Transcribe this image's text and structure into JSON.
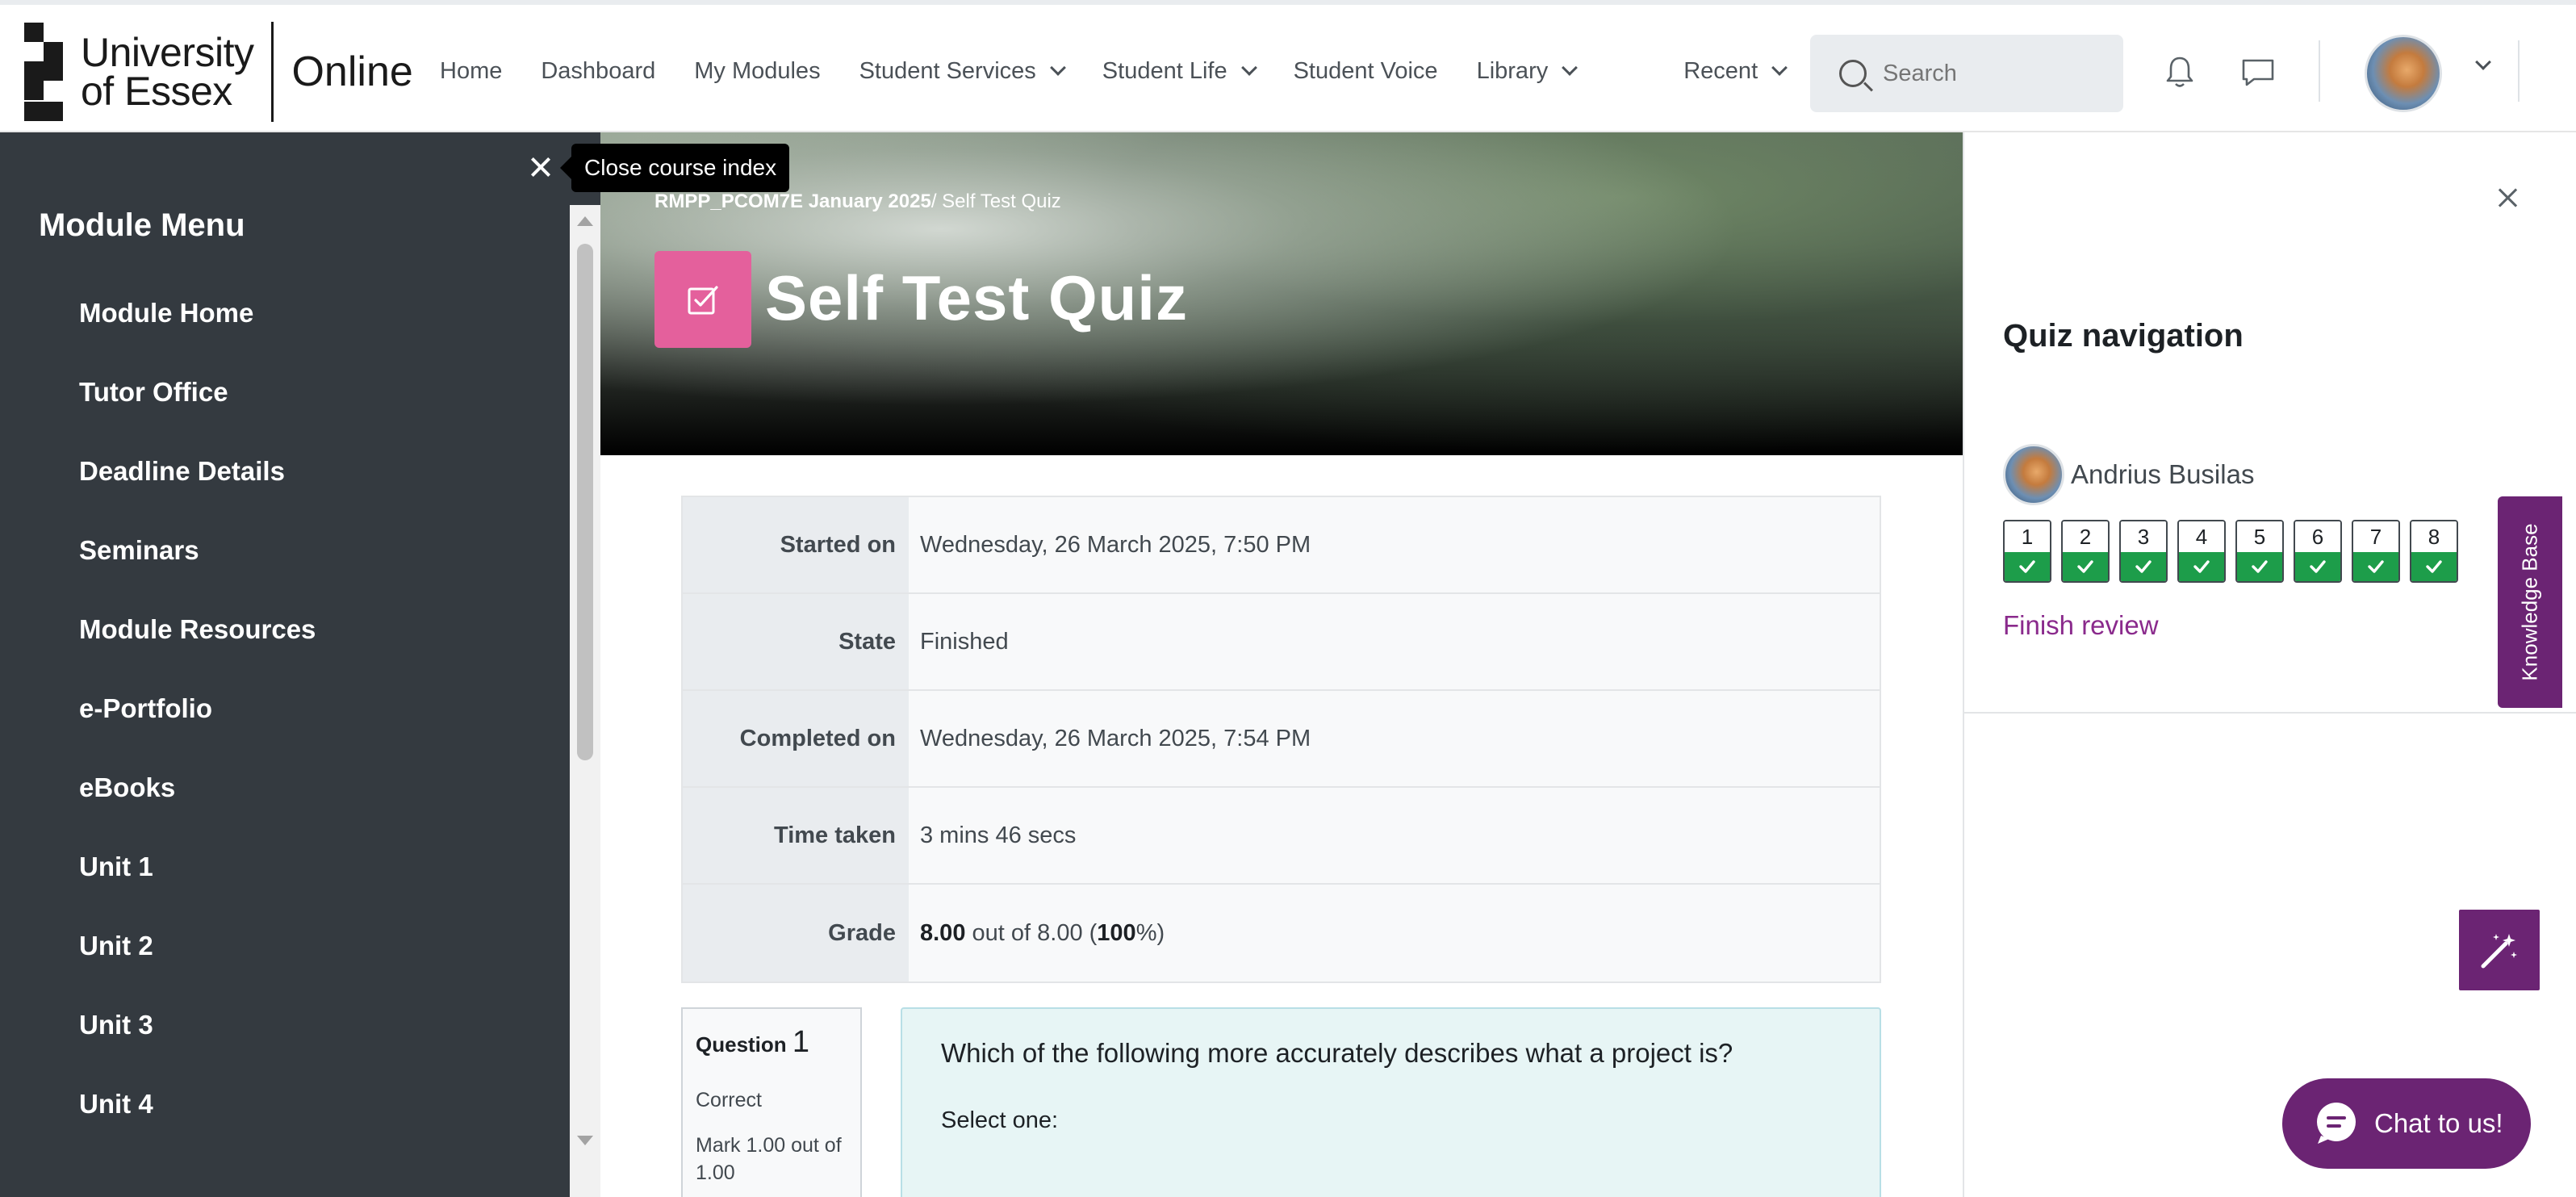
{
  "brand": {
    "university_line1": "University",
    "university_line2": "of Essex",
    "online": "Online"
  },
  "nav": {
    "items": [
      {
        "label": "Home",
        "dropdown": false
      },
      {
        "label": "Dashboard",
        "dropdown": false
      },
      {
        "label": "My Modules",
        "dropdown": false
      },
      {
        "label": "Student Services",
        "dropdown": true
      },
      {
        "label": "Student Life",
        "dropdown": true
      },
      {
        "label": "Student Voice",
        "dropdown": false
      },
      {
        "label": "Library",
        "dropdown": true
      }
    ],
    "recent": "Recent",
    "search_placeholder": "Search"
  },
  "drawer": {
    "close_tooltip": "Close course index",
    "title": "Module Menu",
    "items": [
      "Module Home",
      "Tutor Office",
      "Deadline Details",
      "Seminars",
      "Module Resources",
      "e-Portfolio",
      "eBooks",
      "Unit 1",
      "Unit 2",
      "Unit 3",
      "Unit 4"
    ]
  },
  "hero": {
    "breadcrumb_course": "RMPP_PCOM7E January 2025",
    "breadcrumb_separator": "/",
    "breadcrumb_page": "Self Test Quiz",
    "title": "Self Test Quiz",
    "icon_color": "#e4609c"
  },
  "summary": {
    "rows": [
      {
        "label": "Started on",
        "value": "Wednesday, 26 March 2025, 7:50 PM"
      },
      {
        "label": "State",
        "value": "Finished"
      },
      {
        "label": "Completed on",
        "value": "Wednesday, 26 March 2025, 7:54 PM"
      },
      {
        "label": "Time taken",
        "value": "3 mins 46 secs"
      }
    ],
    "grade_label": "Grade",
    "grade_score": "8.00",
    "grade_mid": "out of 8.00 (",
    "grade_percent": "100",
    "grade_end": "%)"
  },
  "question": {
    "label": "Question",
    "number": "1",
    "state": "Correct",
    "mark": "Mark 1.00 out of 1.00",
    "text": "Which of the following more accurately describes what a project is?",
    "select_prompt": "Select one:"
  },
  "quiz_nav": {
    "title": "Quiz navigation",
    "user": "Andrius Busilas",
    "questions": [
      "1",
      "2",
      "3",
      "4",
      "5",
      "6",
      "7",
      "8"
    ],
    "question_state": "correct",
    "finish_review": "Finish review"
  },
  "side_tabs": {
    "knowledge_base": "Knowledge Base"
  },
  "chat": {
    "label": "Chat to us!"
  },
  "colors": {
    "brand_purple": "#6b2473",
    "correct_green": "#1d9d4a",
    "drawer_bg": "#343a40",
    "link_purple": "#8a2a8c"
  }
}
